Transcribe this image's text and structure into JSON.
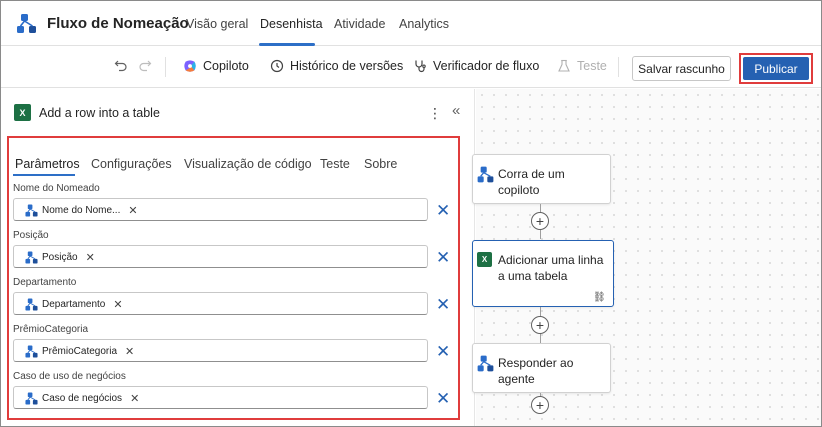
{
  "app": {
    "title": "Fluxo de Nomeação"
  },
  "nav": {
    "tabs": [
      {
        "label": "Visão geral"
      },
      {
        "label": "Desenhista"
      },
      {
        "label": "Atividade"
      },
      {
        "label": "Analytics"
      }
    ],
    "active": "Desenhista"
  },
  "toolbar": {
    "copilot": "Copiloto",
    "history": "Histórico de versões",
    "checker": "Verificador de fluxo",
    "test": "Teste",
    "save_draft": "Salvar rascunho",
    "publish": "Publicar"
  },
  "panel": {
    "title": "Add a row into a table",
    "tabs": [
      {
        "label": "Parâmetros"
      },
      {
        "label": "Configurações"
      },
      {
        "label": "Visualização de código"
      },
      {
        "label": "Teste"
      },
      {
        "label": "Sobre"
      }
    ],
    "fields": [
      {
        "label": "Nome do Nomeado",
        "chip": "Nome do Nome..."
      },
      {
        "label": "Posição",
        "chip": "Posição"
      },
      {
        "label": "Departamento",
        "chip": "Departamento"
      },
      {
        "label": "PrêmioCategoria",
        "chip": "PrêmioCategoria"
      },
      {
        "label": "Caso de uso de negócios",
        "chip": "Caso de negócios"
      }
    ]
  },
  "canvas": {
    "nodes": [
      {
        "label": "Corra de um copiloto"
      },
      {
        "label": "Adicionar uma linha a uma tabela"
      },
      {
        "label": "Responder ao agente"
      }
    ]
  },
  "colors": {
    "accent": "#2561b2",
    "highlight": "#e03c3c",
    "excel": "#1d7044"
  }
}
